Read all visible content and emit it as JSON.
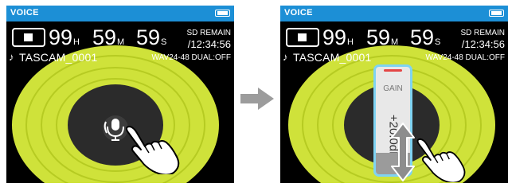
{
  "screens": [
    {
      "title": "VOICE",
      "time": {
        "hours": "99",
        "hours_unit": "H",
        "minutes": "59",
        "minutes_unit": "M",
        "seconds": "59",
        "seconds_unit": "S"
      },
      "remain_label": "SD REMAIN",
      "remain_time": "/12:34:56",
      "filename": "TASCAM_0001",
      "format": "WAV24-48 DUAL:OFF"
    },
    {
      "title": "VOICE",
      "time": {
        "hours": "99",
        "hours_unit": "H",
        "minutes": "59",
        "minutes_unit": "M",
        "seconds": "59",
        "seconds_unit": "S"
      },
      "remain_label": "SD REMAIN",
      "remain_time": "/12:34:56",
      "filename": "TASCAM_0001",
      "format": "WAV24-48 DUAL:OFF",
      "gain": {
        "label": "GAIN",
        "value": "+20.0dB",
        "level_fraction": 0.2
      }
    }
  ],
  "colors": {
    "title_bar": "#1c8fd6",
    "ring_outer": "#cfe23a",
    "ring_inner": "#b6cb22",
    "center_disc": "#2b2b2b",
    "popup_border": "#7fd3f2",
    "transition_arrow": "#9c9c9c"
  },
  "icons": {
    "stop": "stop-icon",
    "note": "music-note-icon",
    "battery": "battery-icon",
    "mic": "microphone-icon",
    "hand": "pointing-hand-icon",
    "drag": "vertical-drag-arrow-icon",
    "arrow": "right-arrow-icon"
  }
}
